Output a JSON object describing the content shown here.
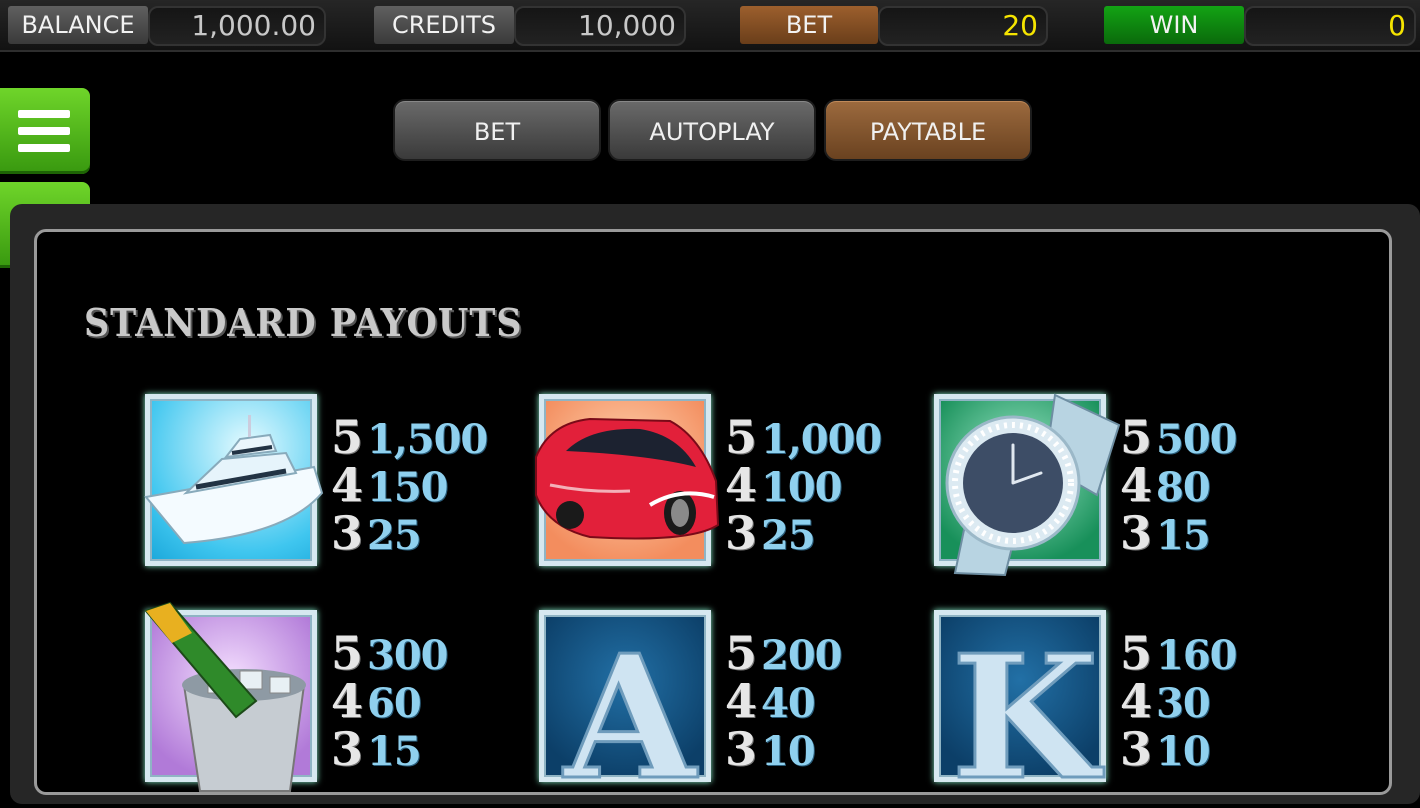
{
  "status_bar": {
    "balance": {
      "label": "BALANCE",
      "value": "1,000.00"
    },
    "credits": {
      "label": "CREDITS",
      "value": "10,000"
    },
    "bet": {
      "label": "BET",
      "value": "20"
    },
    "win": {
      "label": "WIN",
      "value": "0"
    }
  },
  "side_buttons": {
    "menu_icon": "hamburger-menu-icon",
    "back_icon": "arrow-left-icon"
  },
  "tabs": [
    {
      "label": "BET",
      "active": false
    },
    {
      "label": "AUTOPLAY",
      "active": false
    },
    {
      "label": "PAYTABLE",
      "active": true
    }
  ],
  "paytable": {
    "title": "STANDARD PAYOUTS",
    "symbols": [
      {
        "symbol": "yacht",
        "pays": [
          {
            "count": "5",
            "amount": "1,500"
          },
          {
            "count": "4",
            "amount": "150"
          },
          {
            "count": "3",
            "amount": "25"
          }
        ]
      },
      {
        "symbol": "sports-car",
        "pays": [
          {
            "count": "5",
            "amount": "1,000"
          },
          {
            "count": "4",
            "amount": "100"
          },
          {
            "count": "3",
            "amount": "25"
          }
        ]
      },
      {
        "symbol": "watch",
        "pays": [
          {
            "count": "5",
            "amount": "500"
          },
          {
            "count": "4",
            "amount": "80"
          },
          {
            "count": "3",
            "amount": "15"
          }
        ]
      },
      {
        "symbol": "champagne",
        "pays": [
          {
            "count": "5",
            "amount": "300"
          },
          {
            "count": "4",
            "amount": "60"
          },
          {
            "count": "3",
            "amount": "15"
          }
        ]
      },
      {
        "symbol": "ace",
        "letter": "A",
        "pays": [
          {
            "count": "5",
            "amount": "200"
          },
          {
            "count": "4",
            "amount": "40"
          },
          {
            "count": "3",
            "amount": "10"
          }
        ]
      },
      {
        "symbol": "king",
        "letter": "K",
        "pays": [
          {
            "count": "5",
            "amount": "160"
          },
          {
            "count": "4",
            "amount": "30"
          },
          {
            "count": "3",
            "amount": "10"
          }
        ]
      }
    ]
  },
  "colors": {
    "bet_accent": "#9c5f2d",
    "win_accent": "#13a314",
    "side_button": "#5cc022",
    "payout_amount": "#8fd0ee",
    "value_highlight": "#f5e400"
  }
}
